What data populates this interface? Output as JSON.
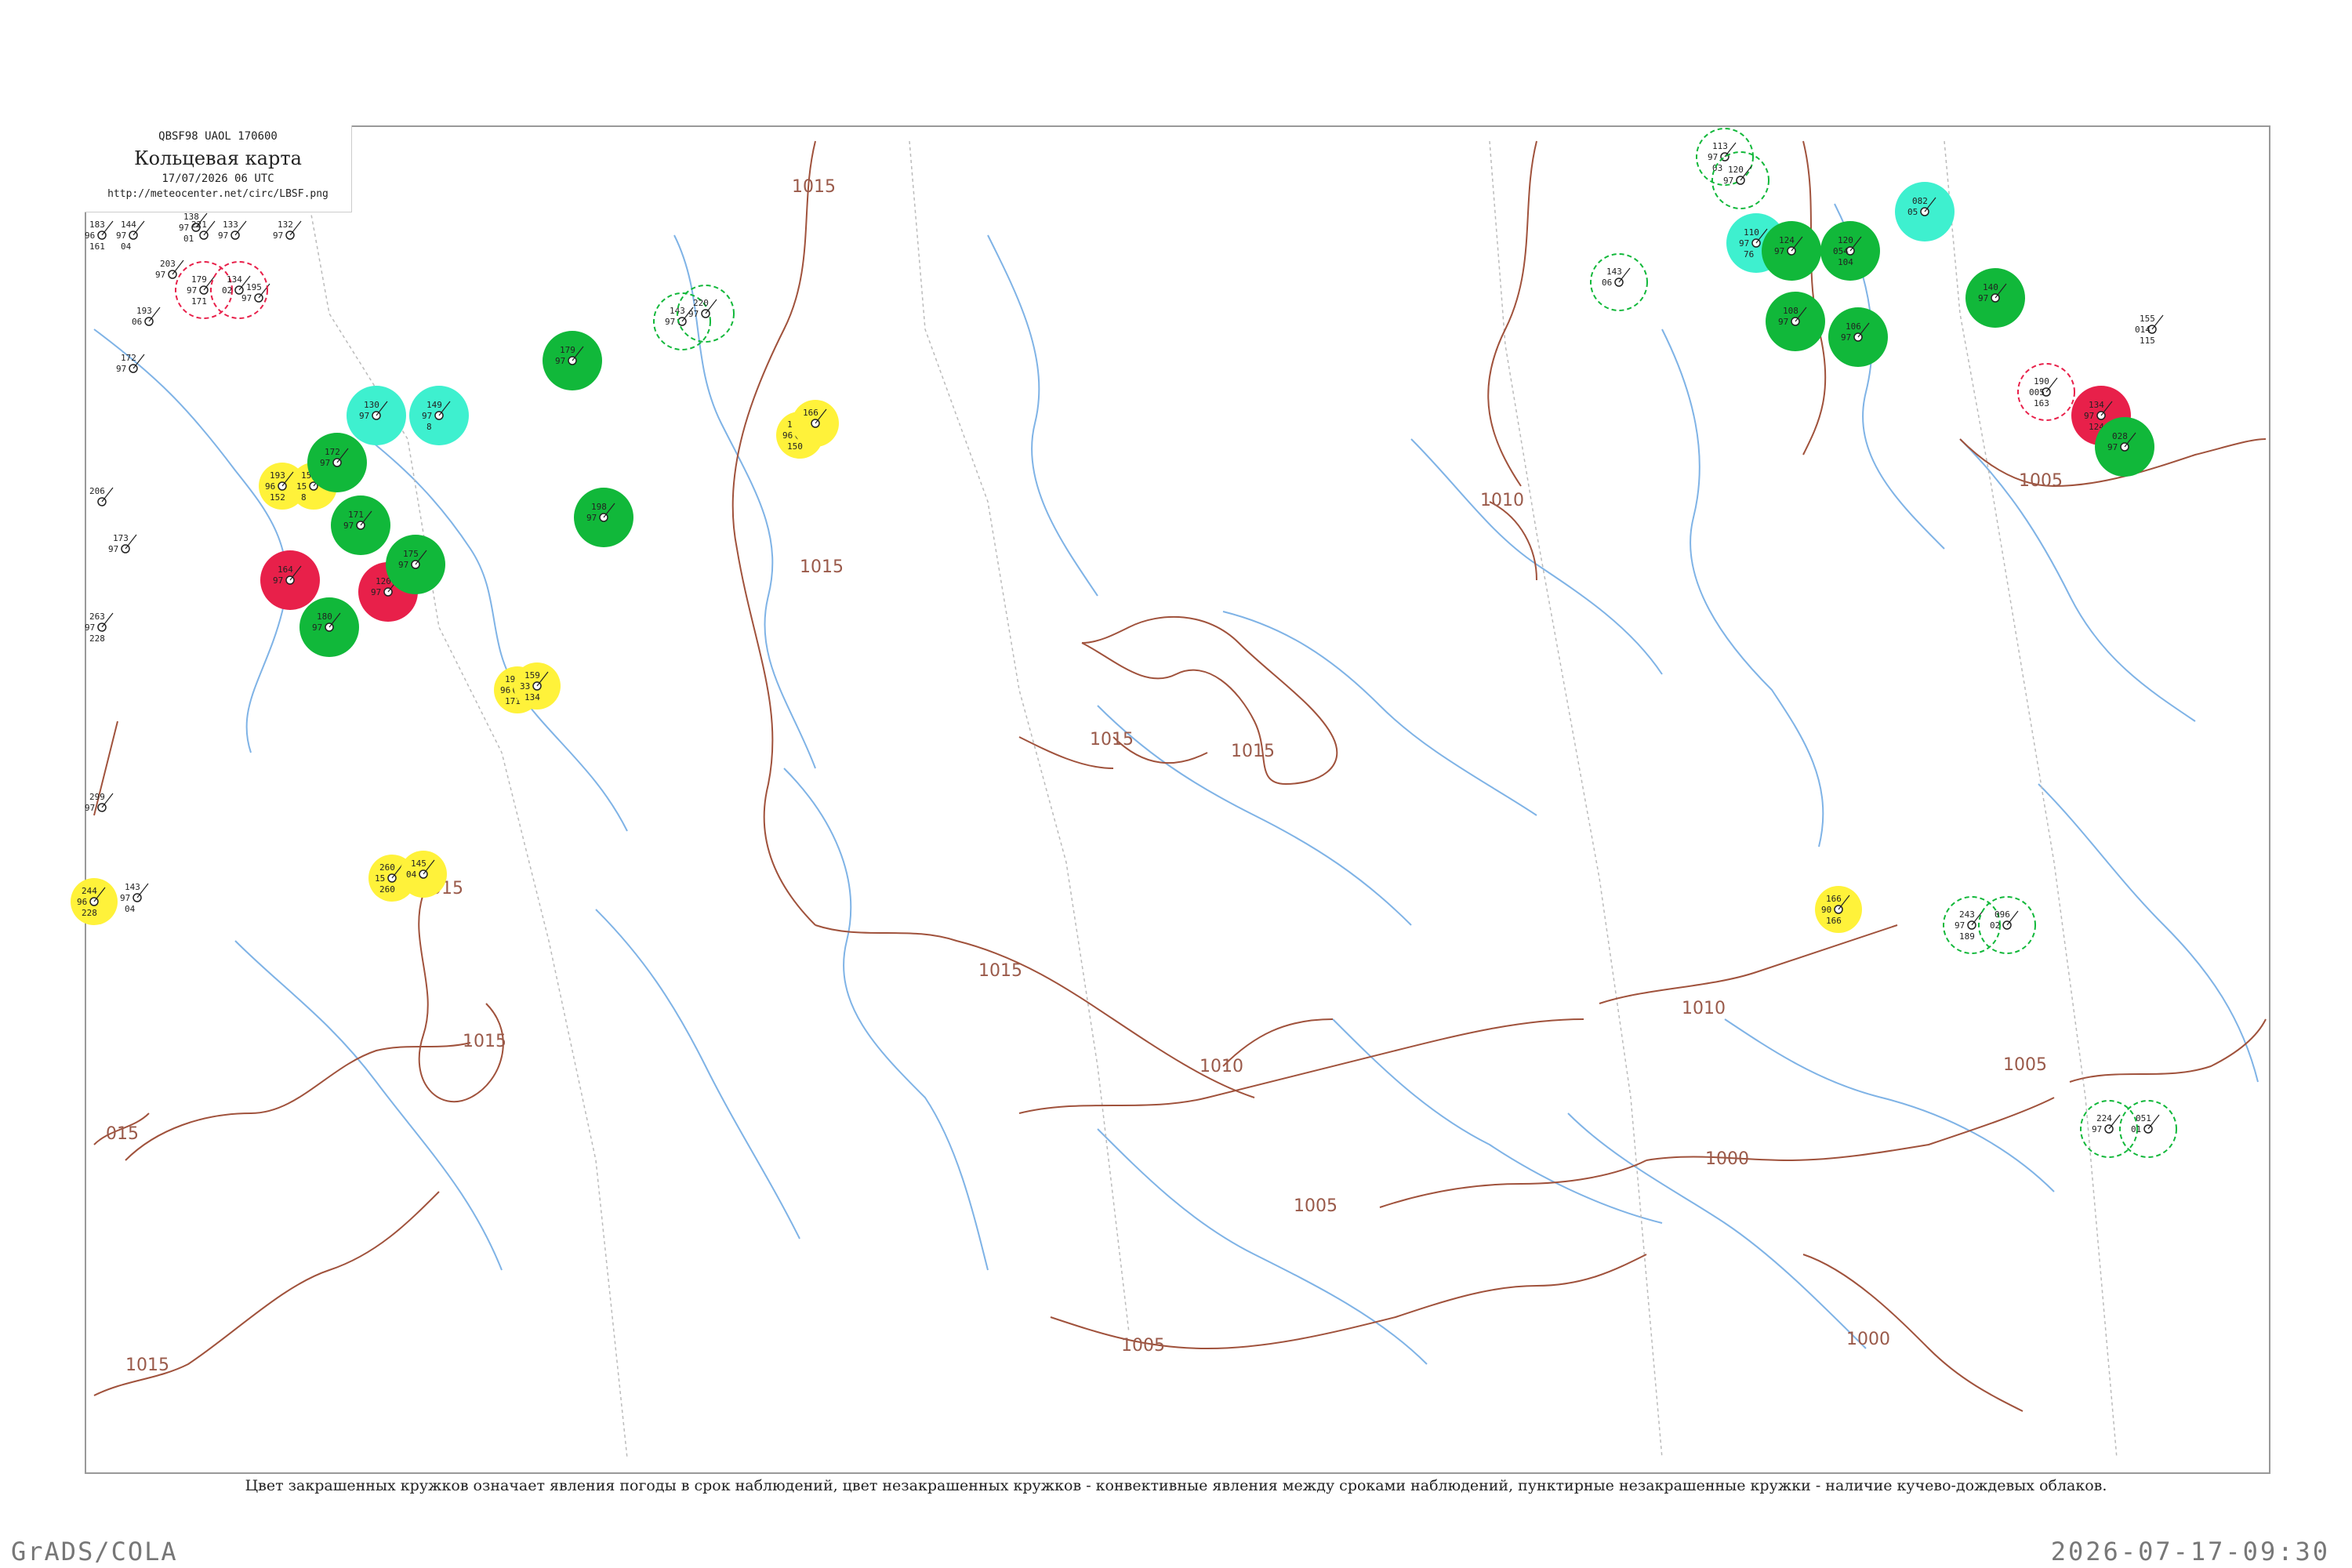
{
  "header": {
    "codes": "QBSF98  UAOL  170600",
    "title": "Кольцевая карта",
    "time": "17/07/2026 06 UTC",
    "url": "http://meteocenter.net/circ/LBSF.png"
  },
  "caption": "Цвет закрашенных кружков означает явления погоды в срок наблюдений, цвет незакрашенных кружков - конвективные явления между сроками наблюдений, пунктирные незакрашенные кружки - наличие кучево-дождевых облаков.",
  "footer": {
    "left": "GrADS/COLA",
    "right": "2026-07-17-09:30"
  },
  "colors": {
    "isobar": "#a0523c",
    "river": "#7fb3e6",
    "green": "#11b83a",
    "yellow": "#fff23a",
    "red": "#e8204a",
    "cyan": "#3ef0cf",
    "station": "#222222"
  },
  "isobars": [
    {
      "label": "1015",
      "label_key": "iso_1015_a"
    },
    {
      "label": "1015",
      "label_key": "iso_1015_b"
    },
    {
      "label": "1015",
      "label_key": "iso_1015_c"
    },
    {
      "label": "1015",
      "label_key": "iso_1015_d"
    },
    {
      "label": "1015",
      "label_key": "iso_1015_e"
    },
    {
      "label": "1015",
      "label_key": "iso_1015_f"
    },
    {
      "label": "1015",
      "label_key": "iso_1015_g"
    },
    {
      "label": "1015",
      "label_key": "iso_1015_h"
    },
    {
      "label": "1010",
      "label_key": "iso_1010_a"
    },
    {
      "label": "1010",
      "label_key": "iso_1010_b"
    },
    {
      "label": "1010",
      "label_key": "iso_1010_c"
    },
    {
      "label": "1005",
      "label_key": "iso_1005_a"
    },
    {
      "label": "1005",
      "label_key": "iso_1005_b"
    },
    {
      "label": "1005",
      "label_key": "iso_1005_c"
    },
    {
      "label": "1005",
      "label_key": "iso_1005_d"
    },
    {
      "label": "1000",
      "label_key": "iso_1000_a"
    },
    {
      "label": "1000",
      "label_key": "iso_1000_b"
    },
    {
      "label": "015",
      "label_key": "iso_015"
    }
  ],
  "stations": [
    {
      "t": "183",
      "v": "96",
      "p": "161",
      "w": "",
      "id": "",
      "type": "plain"
    },
    {
      "t": "144",
      "v": "97",
      "p": "04",
      "w": "",
      "id": "",
      "type": "plain"
    },
    {
      "t": "138",
      "v": "97",
      "p": "01",
      "w": "",
      "id": "",
      "type": "plain"
    },
    {
      "t": "133",
      "v": "97",
      "p": "",
      "w": "",
      "id": "",
      "type": "plain"
    },
    {
      "t": "132",
      "v": "97",
      "p": "",
      "w": "",
      "id": "",
      "type": "plain"
    },
    {
      "t": "193",
      "v": "06",
      "p": "",
      "w": "",
      "id": "",
      "type": "plain"
    },
    {
      "t": "172",
      "v": "97",
      "p": "",
      "w": "",
      "id": "",
      "type": "plain"
    },
    {
      "t": "206",
      "v": "",
      "p": "",
      "w": "",
      "id": "",
      "type": "plain"
    },
    {
      "t": "173",
      "v": "97",
      "p": "",
      "w": "",
      "id": "",
      "type": "plain"
    },
    {
      "t": "263",
      "v": "97",
      "p": "228",
      "w": "",
      "id": "",
      "type": "plain"
    },
    {
      "t": "299",
      "v": "97",
      "p": "",
      "w": "",
      "id": "",
      "type": "plain"
    },
    {
      "t": "244",
      "v": "96",
      "p": "228",
      "w": "",
      "id": "",
      "type": "yellow"
    },
    {
      "t": "143",
      "v": "97",
      "p": "04",
      "w": "",
      "id": "",
      "type": "plain"
    },
    {
      "t": "203",
      "v": "97",
      "p": "",
      "w": "",
      "id": "",
      "type": "plain"
    },
    {
      "t": "195",
      "v": "97",
      "p": "",
      "w": "",
      "id": "",
      "type": "plain"
    },
    {
      "t": "221",
      "v": "",
      "p": "",
      "w": "",
      "id": "",
      "type": "plain"
    },
    {
      "t": "193",
      "v": "96",
      "p": "152",
      "w": "",
      "id": "",
      "type": "yellow"
    },
    {
      "t": "155",
      "v": "15",
      "p": "8",
      "w": "",
      "id": "",
      "type": "yellow"
    },
    {
      "t": "172",
      "v": "97",
      "p": "",
      "w": "",
      "id": "",
      "type": "green"
    },
    {
      "t": "171",
      "v": "97",
      "p": "",
      "w": "",
      "id": "",
      "type": "green"
    },
    {
      "t": "164",
      "v": "97",
      "p": "",
      "w": "",
      "id": "",
      "type": "red"
    },
    {
      "t": "120",
      "v": "97",
      "p": "",
      "w": "",
      "id": "",
      "type": "red"
    },
    {
      "t": "180",
      "v": "97",
      "p": "",
      "w": "",
      "id": "",
      "type": "green"
    },
    {
      "t": "130",
      "v": "97",
      "p": "",
      "w": "",
      "id": "",
      "type": "cyan"
    },
    {
      "t": "149",
      "v": "97",
      "p": "8",
      "w": "",
      "id": "",
      "type": "cyan"
    },
    {
      "t": "179",
      "v": "97",
      "p": "",
      "w": "",
      "id": "",
      "type": "green"
    },
    {
      "t": "198",
      "v": "97",
      "p": "",
      "w": "",
      "id": "",
      "type": "green"
    },
    {
      "t": "175",
      "v": "97",
      "p": "",
      "w": "",
      "id": "",
      "type": "green"
    },
    {
      "t": "194",
      "v": "96",
      "p": "171",
      "w": "",
      "id": "",
      "type": "yellow"
    },
    {
      "t": "159",
      "v": "33",
      "p": "134",
      "w": "",
      "id": "",
      "type": "yellow"
    },
    {
      "t": "260",
      "v": "15",
      "p": "260",
      "w": "",
      "id": "",
      "type": "yellow"
    },
    {
      "t": "145",
      "v": "04",
      "p": "",
      "w": "",
      "id": "",
      "type": "yellow"
    },
    {
      "t": "187",
      "v": "96",
      "p": "150",
      "w": "",
      "id": "",
      "type": "yellow"
    },
    {
      "t": "166",
      "v": "",
      "p": "",
      "w": "",
      "id": "",
      "type": "yellow"
    },
    {
      "t": "166",
      "v": "90",
      "p": "166",
      "w": "",
      "id": "",
      "type": "yellow"
    },
    {
      "t": "113",
      "v": "97",
      "p": "03",
      "w": "",
      "id": "",
      "type": "green-dashed"
    },
    {
      "t": "120",
      "v": "97",
      "p": "",
      "w": "",
      "id": "",
      "type": "green-dashed"
    },
    {
      "t": "110",
      "v": "97",
      "p": "76",
      "w": "",
      "id": "",
      "type": "cyan"
    },
    {
      "t": "124",
      "v": "97",
      "p": "",
      "w": "",
      "id": "",
      "type": "green"
    },
    {
      "t": "108",
      "v": "97",
      "p": "",
      "w": "",
      "id": "",
      "type": "green"
    },
    {
      "t": "106",
      "v": "97",
      "p": "",
      "w": "",
      "id": "",
      "type": "green"
    },
    {
      "t": "082",
      "v": "05",
      "p": "",
      "w": "",
      "id": "",
      "type": "cyan"
    },
    {
      "t": "120",
      "v": "054",
      "p": "104",
      "w": "",
      "id": "",
      "type": "green"
    },
    {
      "t": "140",
      "v": "97",
      "p": "",
      "w": "",
      "id": "",
      "type": "green"
    },
    {
      "t": "155",
      "v": "014",
      "p": "115",
      "w": "",
      "id": "",
      "type": "plain"
    },
    {
      "t": "190",
      "v": "005",
      "p": "163",
      "w": "",
      "id": "",
      "type": "red-dashed"
    },
    {
      "t": "134",
      "v": "97",
      "p": "124",
      "w": "",
      "id": "",
      "type": "red"
    },
    {
      "t": "028",
      "v": "97",
      "p": "",
      "w": "",
      "id": "",
      "type": "green"
    },
    {
      "t": "224",
      "v": "97",
      "p": "",
      "w": "",
      "id": "",
      "type": "green-dashed"
    },
    {
      "t": "051",
      "v": "01",
      "p": "",
      "w": "",
      "id": "",
      "type": "green-dashed"
    },
    {
      "t": "243",
      "v": "97",
      "p": "189",
      "w": "",
      "id": "",
      "type": "green-dashed"
    },
    {
      "t": "096",
      "v": "02",
      "p": "",
      "w": "",
      "id": "",
      "type": "green-dashed"
    },
    {
      "t": "143",
      "v": "97",
      "p": "",
      "w": "",
      "id": "",
      "type": "green-dashed"
    },
    {
      "t": "220",
      "v": "97",
      "p": "",
      "w": "",
      "id": "",
      "type": "green-dashed"
    },
    {
      "t": "143",
      "v": "06",
      "p": "",
      "w": "",
      "id": "",
      "type": "green-dashed"
    },
    {
      "t": "179",
      "v": "97",
      "p": "171",
      "w": "",
      "id": "",
      "type": "red-dashed"
    },
    {
      "t": "134",
      "v": "02",
      "p": "",
      "w": "",
      "id": "",
      "type": "red-dashed"
    }
  ]
}
